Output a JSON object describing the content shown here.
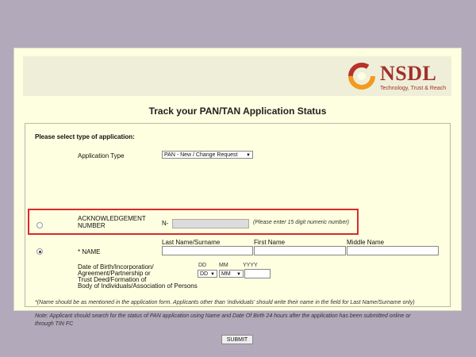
{
  "header": {
    "logo_text": "NSDL",
    "logo_tagline": "Technology, Trust & Reach",
    "logo_colors": {
      "swirl_orange": "#f39a1e",
      "swirl_red": "#b8322b",
      "text": "#a0302c"
    }
  },
  "page_title": "Track your PAN/TAN Application Status",
  "form": {
    "select_type_label": "Please select type of application:",
    "application_type_label": "Application Type",
    "application_type_value": "PAN - New / Change Request",
    "ack_label_line1": "ACKNOWLEDGEMENT",
    "ack_label_line2": "NUMBER",
    "ack_prefix": "N-",
    "ack_hint": "(Please enter 15 digit numeric number)",
    "name_label": "* NAME",
    "last_name_label": "Last Name/Surname",
    "first_name_label": "First Name",
    "middle_name_label": "Middle Name",
    "dob_label_line1": "Date of Birth/Incorporation/",
    "dob_label_line2": "Agreement/Partnership or",
    "dob_label_line3": "Trust Deed/Formation of",
    "dob_label_line4": "Body of Individuals/Association of Persons",
    "dd_label": "DD",
    "mm_label": "MM",
    "yyyy_label": "YYYY",
    "dd_value": "DD",
    "mm_value": "MM",
    "note1": "*(Name should be as mentioned in the application form. Applicants other than 'individuals' should write their name in the field for Last Name/Surname only)",
    "note2_line1": "Note: Applicant should search for the status of PAN application using Name and Date Of Birth 24 hours after the application has been submitted online or",
    "note2_line2": "through TIN FC",
    "submit_label": "SUBMIT"
  },
  "highlight_color": "#d72b2b"
}
